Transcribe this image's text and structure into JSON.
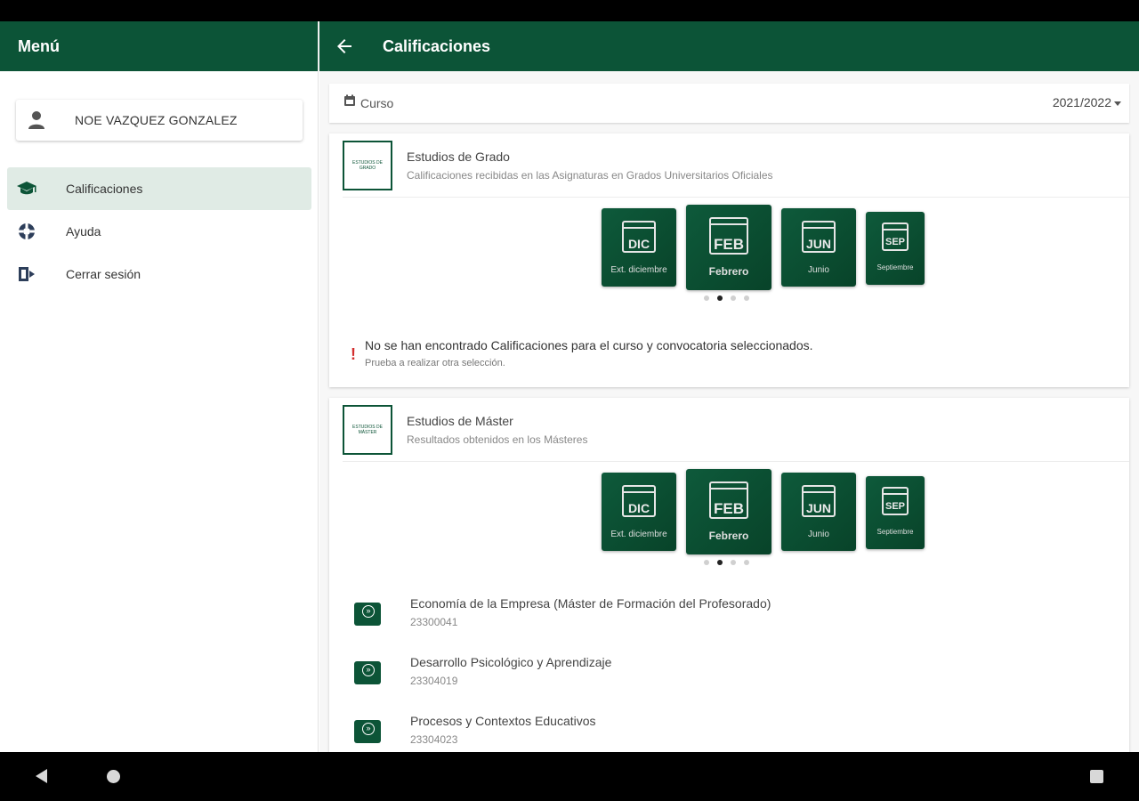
{
  "sidebar": {
    "title": "Menú",
    "user_name": "NOE VAZQUEZ GONZALEZ",
    "items": [
      {
        "label": "Calificaciones",
        "icon": "graduation-cap-icon",
        "active": true
      },
      {
        "label": "Ayuda",
        "icon": "lifebuoy-icon",
        "active": false
      },
      {
        "label": "Cerrar sesión",
        "icon": "logout-icon",
        "active": false
      }
    ]
  },
  "header": {
    "title": "Calificaciones"
  },
  "curso": {
    "label": "Curso",
    "selected_year": "2021/2022"
  },
  "cards": [
    {
      "title": "Estudios de Grado",
      "subtitle": "Calificaciones recibidas en las Asignaturas en Grados Universitarios Oficiales",
      "logo_text": "ESTUDIOS DE GRADO",
      "calendar_tiles": [
        {
          "month": "DIC",
          "name": "Ext. diciembre"
        },
        {
          "month": "FEB",
          "name": "Febrero"
        },
        {
          "month": "JUN",
          "name": "Junio"
        },
        {
          "month": "SEP",
          "name": "Septiembre"
        }
      ],
      "active_tile_index": 1,
      "dots_count": 4,
      "empty_title": "No se han encontrado Calificaciones para el curso y convocatoria seleccionados.",
      "empty_sub": "Prueba a realizar otra selección."
    },
    {
      "title": "Estudios de Máster",
      "subtitle": "Resultados obtenidos en los Másteres",
      "logo_text": "ESTUDIOS DE MÁSTER",
      "calendar_tiles": [
        {
          "month": "DIC",
          "name": "Ext. diciembre"
        },
        {
          "month": "FEB",
          "name": "Febrero"
        },
        {
          "month": "JUN",
          "name": "Junio"
        },
        {
          "month": "SEP",
          "name": "Septiembre"
        }
      ],
      "active_tile_index": 1,
      "dots_count": 4,
      "subjects": [
        {
          "name": "Economía de la Empresa (Máster de Formación del Profesorado)",
          "code": "23300041"
        },
        {
          "name": "Desarrollo Psicológico y Aprendizaje",
          "code": "23304019"
        },
        {
          "name": "Procesos y Contextos Educativos",
          "code": "23304023"
        }
      ]
    }
  ],
  "colors": {
    "brand_green": "#0c5437",
    "active_bg": "#e0ebe5",
    "warning_red": "#d32f2f"
  }
}
